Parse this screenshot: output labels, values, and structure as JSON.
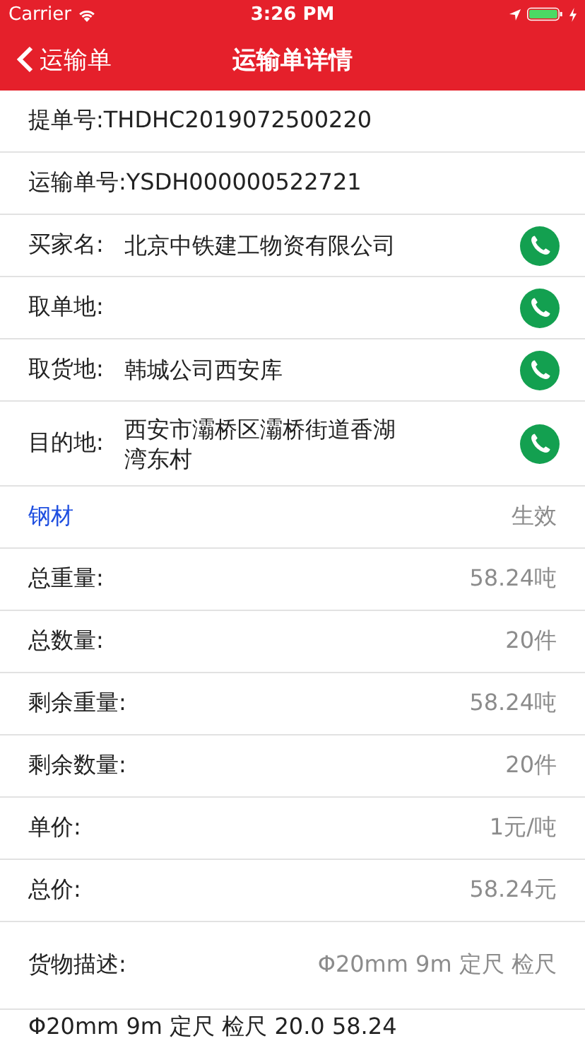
{
  "status_bar": {
    "carrier": "Carrier",
    "time": "3:26 PM"
  },
  "nav": {
    "back": "运输单",
    "title": "运输单详情"
  },
  "rows": [
    {
      "kind": "plain",
      "text": "提单号:THDHC2019072500220"
    },
    {
      "kind": "plain",
      "text": "运输单号:YSDH000000522721"
    },
    {
      "kind": "contact",
      "label": "买家名:",
      "value": "北京中铁建工物资有限公司"
    },
    {
      "kind": "contact",
      "label": "取单地:"
    },
    {
      "kind": "contact",
      "label": "取货地:",
      "value": "韩城公司西安库"
    },
    {
      "kind": "contact",
      "label": "目的地:",
      "value": "西安市灞桥区灞桥街道香湖湾东村"
    },
    {
      "kind": "section",
      "label": "钢材",
      "value": "生效"
    },
    {
      "kind": "stat",
      "label": "总重量:",
      "value": "58.24吨"
    },
    {
      "kind": "stat",
      "label": "总数量:",
      "value": "20件"
    },
    {
      "kind": "stat",
      "label": "剩余重量:",
      "value": "58.24吨"
    },
    {
      "kind": "stat",
      "label": "剩余数量:",
      "value": "20件"
    },
    {
      "kind": "stat",
      "label": "单价:",
      "value": "1元/吨"
    },
    {
      "kind": "stat",
      "label": "总价:",
      "value": "58.24元"
    },
    {
      "kind": "desc",
      "label": "货物描述:",
      "value": "Φ20mm 9m 定尺 检尺"
    },
    {
      "kind": "line",
      "text": "Φ20mm 9m 定尺 检尺 20.0 58.24"
    }
  ]
}
